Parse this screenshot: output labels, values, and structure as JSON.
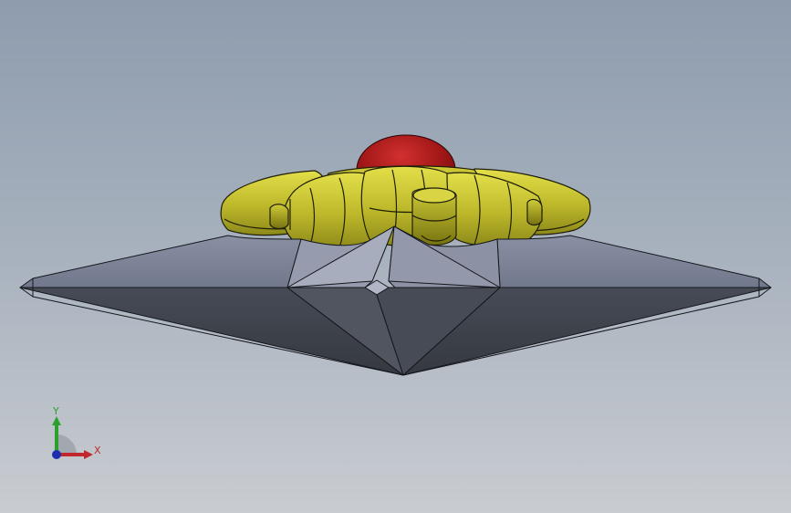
{
  "triad": {
    "x_label": "X",
    "y_label": "Y",
    "x_color": "#c0282e",
    "y_color": "#2ca02c",
    "z_color": "#1c2fb0"
  },
  "model": {
    "dome_color": "#b01a1a",
    "petals_color": "#c9c430",
    "base_top_color": "#7f8698",
    "base_bottom_color": "#3f434d"
  }
}
